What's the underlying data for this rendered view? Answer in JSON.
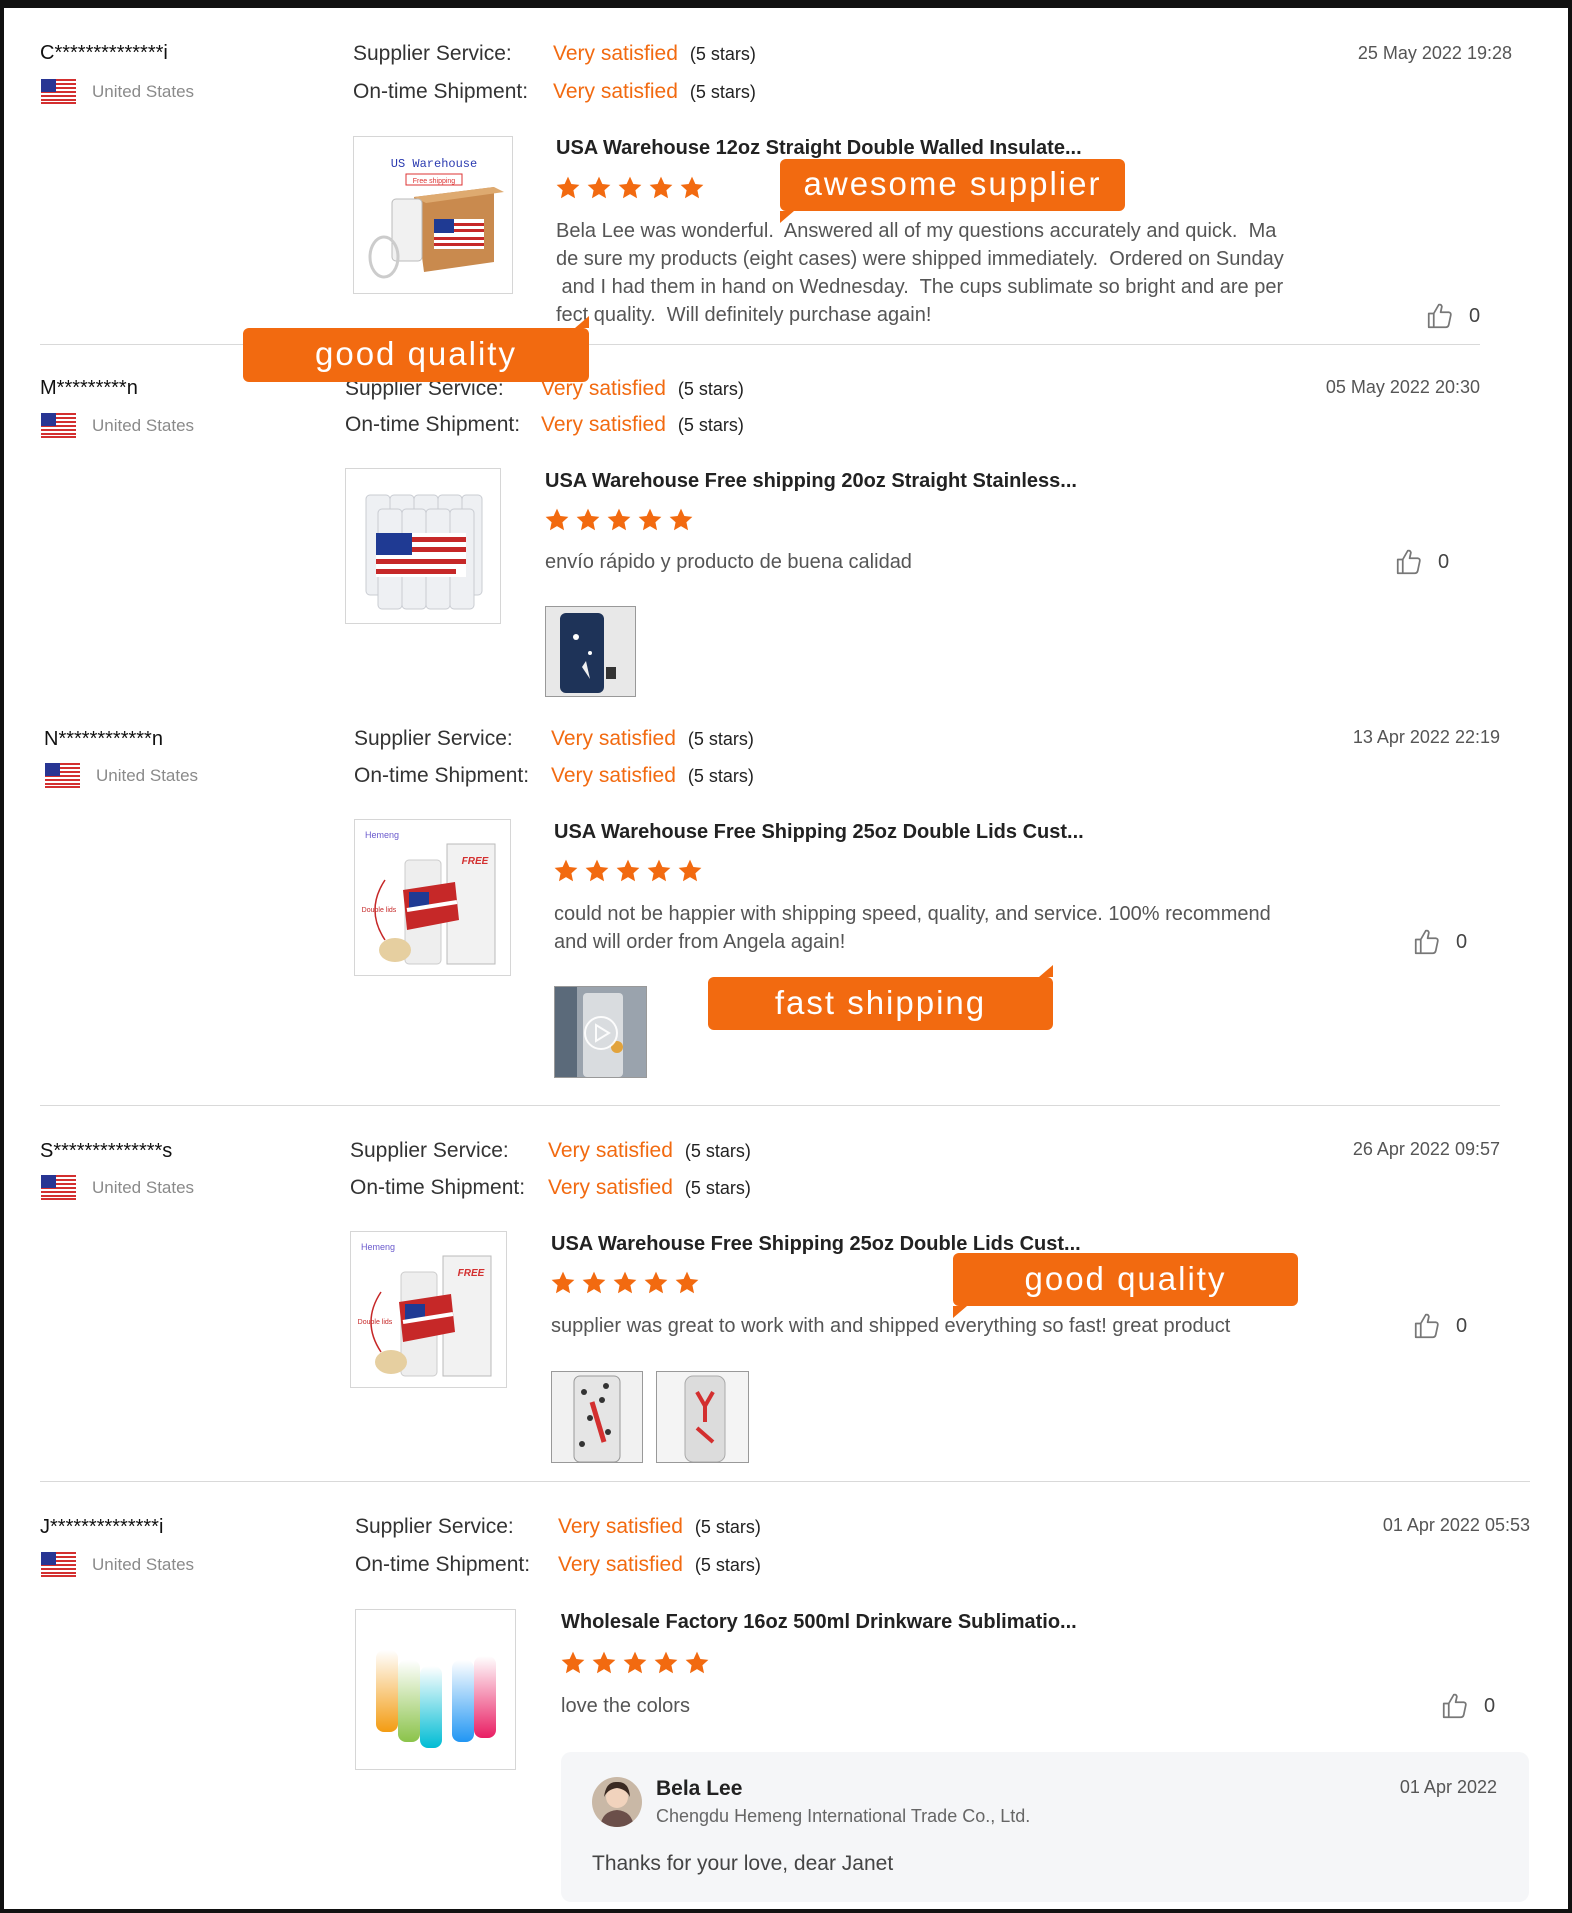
{
  "labels": {
    "supplier_service": "Supplier Service:",
    "ontime_shipment": "On-time Shipment:",
    "five_stars": "(5 stars)"
  },
  "colors": {
    "accent": "#f26a10",
    "divider": "#d9d9d9"
  },
  "icons": {
    "like": "thumbs-up-icon",
    "flag": "us-flag-icon",
    "star": "star-icon",
    "play": "play-icon"
  },
  "reviews": [
    {
      "user": "C**************i",
      "country": "United States",
      "supplier_service": "Very satisfied",
      "ontime_shipment": "Very satisfied",
      "date": "25 May 2022 19:28",
      "product_title": "USA Warehouse 12oz Straight Double Walled Insulate...",
      "product_image_text": [
        "US Warehouse",
        "Free shipping"
      ],
      "rating": 5,
      "text": [
        "Bela Lee was wonderful.  Answered all of my questions accurately and quick.  Ma",
        "de sure my products (eight cases) were shipped immediately.  Ordered on Sunday",
        " and I had them in hand on Wednesday.  The cups sublimate so bright and are per",
        "fect quality.  Will definitely purchase again!"
      ],
      "likes": "0"
    },
    {
      "user": "M*********n",
      "country": "United States",
      "supplier_service": "Very satisfied",
      "ontime_shipment": "Very satisfied",
      "date": "05 May 2022 20:30",
      "product_title": "USA Warehouse Free shipping 20oz Straight Stainless...",
      "rating": 5,
      "text": [
        "envío rápido y producto de buena calidad"
      ],
      "likes": "0"
    },
    {
      "user": "N************n",
      "country": "United States",
      "supplier_service": "Very satisfied",
      "ontime_shipment": "Very satisfied",
      "date": "13 Apr 2022 22:19",
      "product_title": "USA Warehouse Free Shipping 25oz Double Lids Cust...",
      "product_image_text": [
        "Hemeng",
        "FREE",
        "Double lids"
      ],
      "rating": 5,
      "text": [
        "could not be happier with shipping speed, quality, and service. 100% recommend",
        "and will order from Angela again!"
      ],
      "likes": "0"
    },
    {
      "user": "S**************s",
      "country": "United States",
      "supplier_service": "Very satisfied",
      "ontime_shipment": "Very satisfied",
      "date": "26 Apr 2022 09:57",
      "product_title": "USA Warehouse Free Shipping 25oz Double Lids Cust...",
      "product_image_text": [
        "Hemeng",
        "FREE",
        "Double lids"
      ],
      "rating": 5,
      "text": [
        "supplier was great to work with and shipped everything so fast! great product"
      ],
      "likes": "0"
    },
    {
      "user": "J**************i",
      "country": "United States",
      "supplier_service": "Very satisfied",
      "ontime_shipment": "Very satisfied",
      "date": "01 Apr 2022 05:53",
      "product_title": "Wholesale Factory 16oz 500ml Drinkware Sublimatio...",
      "rating": 5,
      "text": [
        "love the colors"
      ],
      "likes": "0",
      "reply": {
        "name": "Bela Lee",
        "company": "Chengdu Hemeng International Trade Co., Ltd.",
        "date": "01 Apr 2022",
        "text": "Thanks for your love, dear Janet"
      }
    }
  ],
  "callouts": {
    "awesome_supplier": "awesome supplier",
    "good_quality_1": "good quality",
    "fast_shipping": "fast shipping",
    "good_quality_2": "good quality"
  }
}
